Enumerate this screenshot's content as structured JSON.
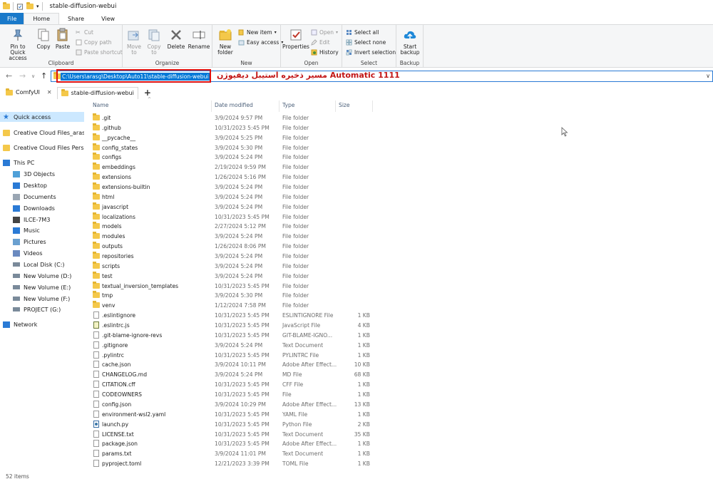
{
  "window": {
    "title": "stable-diffusion-webui"
  },
  "ribbon_tabs": [
    "File",
    "Home",
    "Share",
    "View"
  ],
  "ribbon": {
    "clipboard": {
      "label": "Clipboard",
      "pin": "Pin to Quick access",
      "copy": "Copy",
      "paste": "Paste",
      "cut": "Cut",
      "copy_path": "Copy path",
      "paste_shortcut": "Paste shortcut"
    },
    "organize": {
      "label": "Organize",
      "move_to": "Move to",
      "copy_to": "Copy to",
      "delete": "Delete",
      "rename": "Rename"
    },
    "new": {
      "label": "New",
      "new_folder": "New folder",
      "new_item": "New item",
      "easy_access": "Easy access"
    },
    "open": {
      "label": "Open",
      "properties": "Properties",
      "open": "Open",
      "edit": "Edit",
      "history": "History"
    },
    "select": {
      "label": "Select",
      "select_all": "Select all",
      "select_none": "Select none",
      "invert": "Invert selection"
    },
    "backup": {
      "label": "Backup",
      "start_backup": "Start backup"
    }
  },
  "address": {
    "path": "C:\\Users\\arasg\\Desktop\\Auto11\\stable-diffusion-webui",
    "annotation": "Automatic 1111 مسیر ذخیره استیبل دیفیوژن"
  },
  "folder_tabs": [
    {
      "label": "ComfyUI"
    },
    {
      "label": "stable-diffusion-webui"
    }
  ],
  "nav": [
    {
      "label": "Quick access",
      "icon": "star-icon"
    },
    {
      "label": "Creative Cloud Files_aras",
      "icon": "folder-icon"
    },
    {
      "label": "Creative Cloud Files Perso",
      "icon": "creative-cloud-icon"
    },
    {
      "label": "This PC",
      "icon": "pc-icon"
    },
    {
      "label": "3D Objects",
      "icon": "cube-icon"
    },
    {
      "label": "Desktop",
      "icon": "desktop-icon"
    },
    {
      "label": "Documents",
      "icon": "documents-icon"
    },
    {
      "label": "Downloads",
      "icon": "download-icon"
    },
    {
      "label": "ILCE-7M3",
      "icon": "camera-icon"
    },
    {
      "label": "Music",
      "icon": "music-icon"
    },
    {
      "label": "Pictures",
      "icon": "pictures-icon"
    },
    {
      "label": "Videos",
      "icon": "videos-icon"
    },
    {
      "label": "Local Disk (C:)",
      "icon": "drive-icon"
    },
    {
      "label": "New Volume (D:)",
      "icon": "drive-icon"
    },
    {
      "label": "New Volume (E:)",
      "icon": "drive-icon"
    },
    {
      "label": "New Volume (F:)",
      "icon": "drive-icon"
    },
    {
      "label": "PROJECT (G:)",
      "icon": "drive-icon"
    },
    {
      "label": "Network",
      "icon": "network-icon"
    }
  ],
  "columns": {
    "name": "Name",
    "date": "Date modified",
    "type": "Type",
    "size": "Size"
  },
  "files": [
    {
      "name": ".git",
      "date": "3/9/2024 9:57 PM",
      "type": "File folder",
      "size": "",
      "kind": "folder"
    },
    {
      "name": ".github",
      "date": "10/31/2023 5:45 PM",
      "type": "File folder",
      "size": "",
      "kind": "folder"
    },
    {
      "name": "__pycache__",
      "date": "3/9/2024 5:25 PM",
      "type": "File folder",
      "size": "",
      "kind": "folder"
    },
    {
      "name": "config_states",
      "date": "3/9/2024 5:30 PM",
      "type": "File folder",
      "size": "",
      "kind": "folder"
    },
    {
      "name": "configs",
      "date": "3/9/2024 5:24 PM",
      "type": "File folder",
      "size": "",
      "kind": "folder"
    },
    {
      "name": "embeddings",
      "date": "2/19/2024 9:59 PM",
      "type": "File folder",
      "size": "",
      "kind": "folder"
    },
    {
      "name": "extensions",
      "date": "1/26/2024 5:16 PM",
      "type": "File folder",
      "size": "",
      "kind": "folder"
    },
    {
      "name": "extensions-builtin",
      "date": "3/9/2024 5:24 PM",
      "type": "File folder",
      "size": "",
      "kind": "folder"
    },
    {
      "name": "html",
      "date": "3/9/2024 5:24 PM",
      "type": "File folder",
      "size": "",
      "kind": "folder"
    },
    {
      "name": "javascript",
      "date": "3/9/2024 5:24 PM",
      "type": "File folder",
      "size": "",
      "kind": "folder"
    },
    {
      "name": "localizations",
      "date": "10/31/2023 5:45 PM",
      "type": "File folder",
      "size": "",
      "kind": "folder"
    },
    {
      "name": "models",
      "date": "2/27/2024 5:12 PM",
      "type": "File folder",
      "size": "",
      "kind": "folder"
    },
    {
      "name": "modules",
      "date": "3/9/2024 5:24 PM",
      "type": "File folder",
      "size": "",
      "kind": "folder"
    },
    {
      "name": "outputs",
      "date": "1/26/2024 8:06 PM",
      "type": "File folder",
      "size": "",
      "kind": "folder"
    },
    {
      "name": "repositories",
      "date": "3/9/2024 5:24 PM",
      "type": "File folder",
      "size": "",
      "kind": "folder"
    },
    {
      "name": "scripts",
      "date": "3/9/2024 5:24 PM",
      "type": "File folder",
      "size": "",
      "kind": "folder"
    },
    {
      "name": "test",
      "date": "3/9/2024 5:24 PM",
      "type": "File folder",
      "size": "",
      "kind": "folder"
    },
    {
      "name": "textual_inversion_templates",
      "date": "10/31/2023 5:45 PM",
      "type": "File folder",
      "size": "",
      "kind": "folder"
    },
    {
      "name": "tmp",
      "date": "3/9/2024 5:30 PM",
      "type": "File folder",
      "size": "",
      "kind": "folder"
    },
    {
      "name": "venv",
      "date": "1/12/2024 7:58 PM",
      "type": "File folder",
      "size": "",
      "kind": "folder"
    },
    {
      "name": ".eslintignore",
      "date": "10/31/2023 5:45 PM",
      "type": "ESLINTIGNORE File",
      "size": "1 KB",
      "kind": "file"
    },
    {
      "name": ".eslintrc.js",
      "date": "10/31/2023 5:45 PM",
      "type": "JavaScript File",
      "size": "4 KB",
      "kind": "js"
    },
    {
      "name": ".git-blame-ignore-revs",
      "date": "10/31/2023 5:45 PM",
      "type": "GIT-BLAME-IGNO...",
      "size": "1 KB",
      "kind": "file"
    },
    {
      "name": ".gitignore",
      "date": "3/9/2024 5:24 PM",
      "type": "Text Document",
      "size": "1 KB",
      "kind": "file"
    },
    {
      "name": ".pylintrc",
      "date": "10/31/2023 5:45 PM",
      "type": "PYLINTRC File",
      "size": "1 KB",
      "kind": "file"
    },
    {
      "name": "cache.json",
      "date": "3/9/2024 10:11 PM",
      "type": "Adobe After Effect...",
      "size": "10 KB",
      "kind": "file"
    },
    {
      "name": "CHANGELOG.md",
      "date": "3/9/2024 5:24 PM",
      "type": "MD File",
      "size": "68 KB",
      "kind": "file"
    },
    {
      "name": "CITATION.cff",
      "date": "10/31/2023 5:45 PM",
      "type": "CFF File",
      "size": "1 KB",
      "kind": "file"
    },
    {
      "name": "CODEOWNERS",
      "date": "10/31/2023 5:45 PM",
      "type": "File",
      "size": "1 KB",
      "kind": "file"
    },
    {
      "name": "config.json",
      "date": "3/9/2024 10:29 PM",
      "type": "Adobe After Effect...",
      "size": "13 KB",
      "kind": "file"
    },
    {
      "name": "environment-wsl2.yaml",
      "date": "10/31/2023 5:45 PM",
      "type": "YAML File",
      "size": "1 KB",
      "kind": "file"
    },
    {
      "name": "launch.py",
      "date": "10/31/2023 5:45 PM",
      "type": "Python File",
      "size": "2 KB",
      "kind": "py"
    },
    {
      "name": "LICENSE.txt",
      "date": "10/31/2023 5:45 PM",
      "type": "Text Document",
      "size": "35 KB",
      "kind": "file"
    },
    {
      "name": "package.json",
      "date": "10/31/2023 5:45 PM",
      "type": "Adobe After Effect...",
      "size": "1 KB",
      "kind": "file"
    },
    {
      "name": "params.txt",
      "date": "3/9/2024 11:01 PM",
      "type": "Text Document",
      "size": "1 KB",
      "kind": "file"
    },
    {
      "name": "pyproject.toml",
      "date": "12/21/2023 3:39 PM",
      "type": "TOML File",
      "size": "1 KB",
      "kind": "file"
    }
  ],
  "status": "52 items",
  "colors": {
    "accent": "#1979ca",
    "annotation": "#c21515",
    "selection": "#0078d7",
    "folder": "#f4c84a"
  }
}
